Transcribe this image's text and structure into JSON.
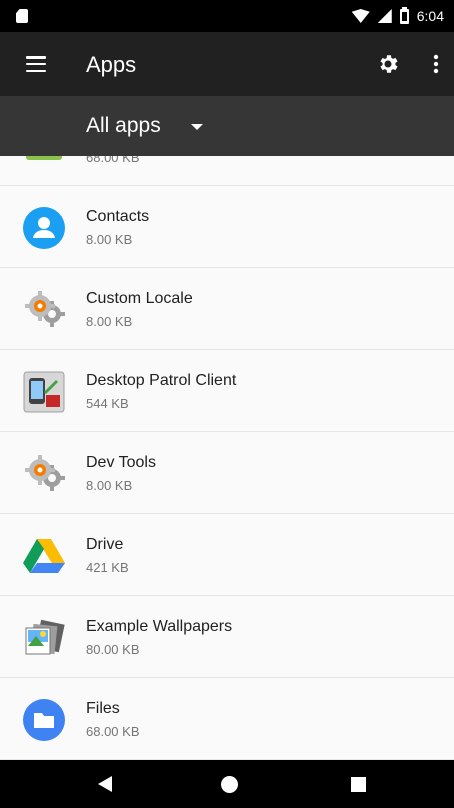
{
  "status_bar": {
    "time": "6:04"
  },
  "app_bar": {
    "title": "Apps",
    "filter_label": "All apps"
  },
  "apps": [
    {
      "name": "",
      "size": "68.00 KB",
      "icon": "app-icon-green"
    },
    {
      "name": "Contacts",
      "size": "8.00 KB",
      "icon": "contacts-icon"
    },
    {
      "name": "Custom Locale",
      "size": "8.00 KB",
      "icon": "gear-app-icon"
    },
    {
      "name": "Desktop Patrol Client",
      "size": "544 KB",
      "icon": "desktop-patrol-icon"
    },
    {
      "name": "Dev Tools",
      "size": "8.00 KB",
      "icon": "gear-app-icon"
    },
    {
      "name": "Drive",
      "size": "421 KB",
      "icon": "drive-icon"
    },
    {
      "name": "Example Wallpapers",
      "size": "80.00 KB",
      "icon": "wallpapers-icon"
    },
    {
      "name": "Files",
      "size": "68.00 KB",
      "icon": "folder-icon"
    }
  ],
  "colors": {
    "app_bar": "#212121",
    "spinner_bar": "#363636",
    "contacts_blue": "#1a9ff2",
    "files_blue": "#3f82f1"
  }
}
